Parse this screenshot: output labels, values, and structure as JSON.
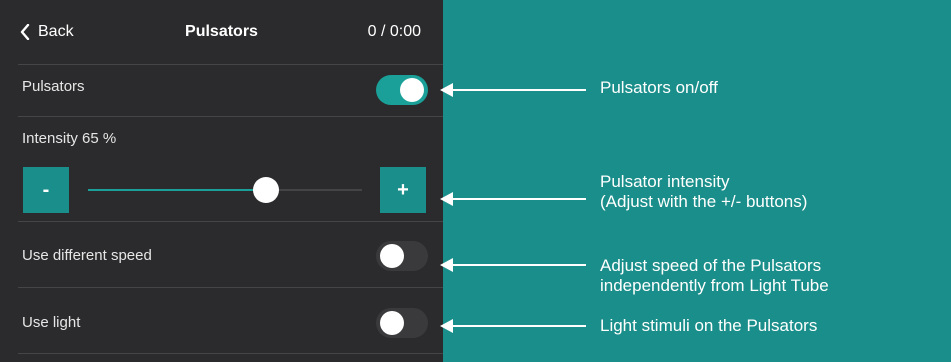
{
  "header": {
    "back_label": "Back",
    "title": "Pulsators",
    "time": "0 / 0:00"
  },
  "settings": {
    "pulsators": {
      "label": "Pulsators",
      "enabled": true
    },
    "intensity": {
      "label": "Intensity 65 %",
      "value_percent": 65,
      "minus_label": "-",
      "plus_label": "+"
    },
    "different_speed": {
      "label": "Use different speed",
      "enabled": false
    },
    "use_light": {
      "label": "Use light",
      "enabled": false
    }
  },
  "callouts": {
    "pulsators": "Pulsators on/off",
    "intensity_line1": "Pulsator intensity",
    "intensity_line2": "(Adjust with the +/- buttons)",
    "speed_line1": "Adjust speed of the Pulsators",
    "speed_line2": "independently from Light Tube",
    "light": "Light stimuli on the Pulsators"
  },
  "colors": {
    "panel_bg": "#2b2b2d",
    "accent": "#1aa098",
    "background": "#1a8e8a"
  },
  "icons": {
    "back": "chevron-left-icon",
    "arrow": "arrow-left-icon"
  }
}
